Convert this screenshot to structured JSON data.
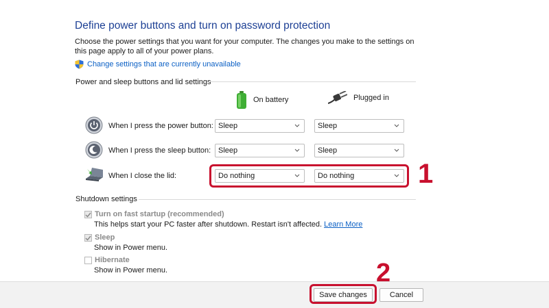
{
  "header": {
    "title": "Define power buttons and turn on password protection",
    "description": "Choose the power settings that you want for your computer. The changes you make to the settings on this page apply to all of your power plans.",
    "change_link": "Change settings that are currently unavailable"
  },
  "power_section": {
    "label": "Power and sleep buttons and lid settings",
    "columns": {
      "battery": "On battery",
      "plugged": "Plugged in"
    },
    "rows": [
      {
        "label": "When I press the power button:",
        "battery": "Sleep",
        "plugged": "Sleep"
      },
      {
        "label": "When I press the sleep button:",
        "battery": "Sleep",
        "plugged": "Sleep"
      },
      {
        "label": "When I close the lid:",
        "battery": "Do nothing",
        "plugged": "Do nothing"
      }
    ]
  },
  "shutdown_section": {
    "label": "Shutdown settings",
    "options": [
      {
        "title": "Turn on fast startup (recommended)",
        "desc": "This helps start your PC faster after shutdown. Restart isn't affected.",
        "link": "Learn More",
        "checked": true
      },
      {
        "title": "Sleep",
        "desc": "Show in Power menu.",
        "checked": true
      },
      {
        "title": "Hibernate",
        "desc": "Show in Power menu.",
        "checked": false
      }
    ]
  },
  "annotations": {
    "step1": "1",
    "step2": "2",
    "highlight_color": "#c8102e"
  },
  "footer": {
    "save": "Save changes",
    "cancel": "Cancel"
  },
  "colors": {
    "title": "#1c3f94",
    "link": "#0a5fc4"
  }
}
